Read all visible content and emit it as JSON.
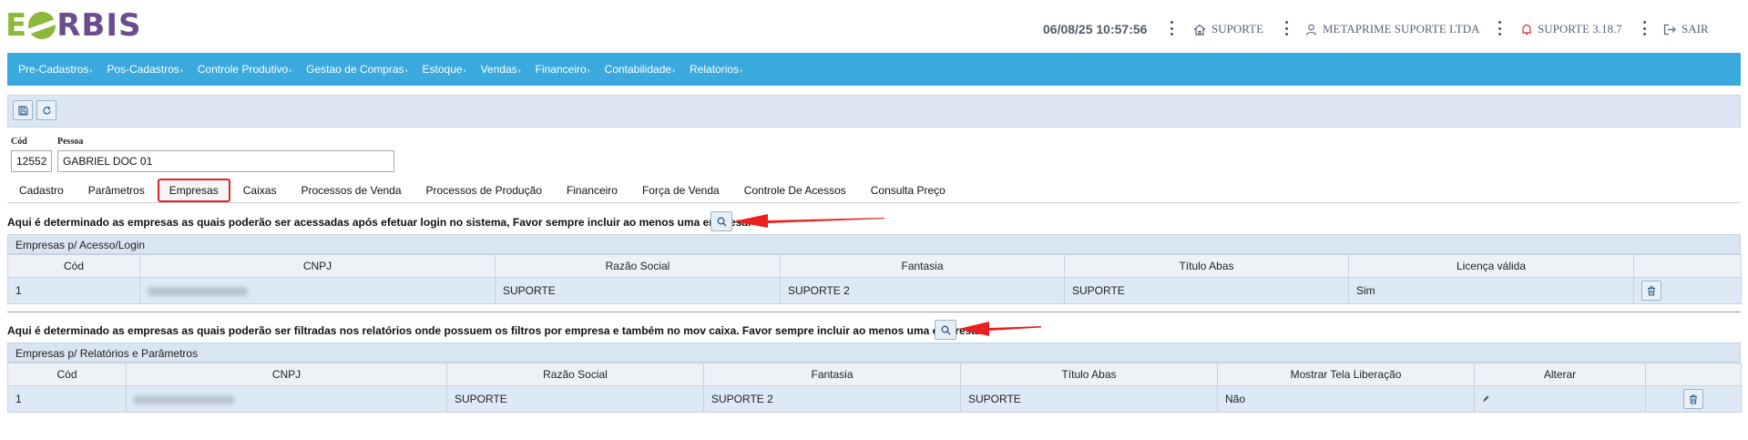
{
  "header": {
    "logo": {
      "e": "E",
      "rest": "RBIS"
    },
    "datetime": "06/08/25 10:57:56",
    "location": "SUPORTE",
    "company": "METAPRIME SUPORTE LTDA",
    "version": "SUPORTE 3.18.7",
    "logout": "SAIR"
  },
  "menu": [
    "Pre-Cadastros",
    "Pos-Cadastros",
    "Controle Produtivo",
    "Gestao de Compras",
    "Estoque",
    "Vendas",
    "Financeiro",
    "Contabilidade",
    "Relatorios"
  ],
  "form": {
    "cod_label": "Cód",
    "cod_value": "12552",
    "pessoa_label": "Pessoa",
    "pessoa_value": "GABRIEL DOC 01"
  },
  "tabs": [
    "Cadastro",
    "Parâmetros",
    "Empresas",
    "Caixas",
    "Processos de Venda",
    "Processos de Produção",
    "Financeiro",
    "Força de Venda",
    "Controle De Acessos",
    "Consulta Preço"
  ],
  "active_tab": "Empresas",
  "section1": {
    "note": "Aqui é determinado as empresas as quais poderão ser acessadas após efetuar login no sistema, Favor sempre incluir ao menos uma empresa.",
    "title": "Empresas p/ Acesso/Login",
    "columns": [
      "Cód",
      "CNPJ",
      "Razão Social",
      "Fantasia",
      "Título Abas",
      "Licença válida",
      ""
    ],
    "rows": [
      {
        "cod": "1",
        "razao": "SUPORTE",
        "fantasia": "SUPORTE 2",
        "titulo": "SUPORTE",
        "licenca": "Sim"
      }
    ]
  },
  "section2": {
    "note": "Aqui é determinado as empresas as quais poderão ser filtradas nos relatórios onde possuem os filtros por empresa e também no mov caixa. Favor sempre incluir ao menos uma empresa.",
    "title": "Empresas p/ Relatórios e Parâmetros",
    "columns": [
      "Cód",
      "CNPJ",
      "Razão Social",
      "Fantasia",
      "Título Abas",
      "Mostrar Tela Liberação",
      "Alterar",
      ""
    ],
    "rows": [
      {
        "cod": "1",
        "razao": "SUPORTE",
        "fantasia": "SUPORTE 2",
        "titulo": "SUPORTE",
        "mostrar": "Não"
      }
    ]
  },
  "colors": {
    "menubar": "#3aa9dd",
    "logo_green": "#8bb83a",
    "logo_purple": "#6b4c8f",
    "active_tab_border": "#d9262c",
    "annotation_arrow": "#e8211e",
    "link": "#2d7fc0"
  },
  "icons": [
    "save-icon",
    "refresh-icon",
    "home-icon",
    "user-icon",
    "bell-icon",
    "logout-icon",
    "search-icon",
    "trash-icon",
    "pencil-icon",
    "kebab-icon"
  ]
}
